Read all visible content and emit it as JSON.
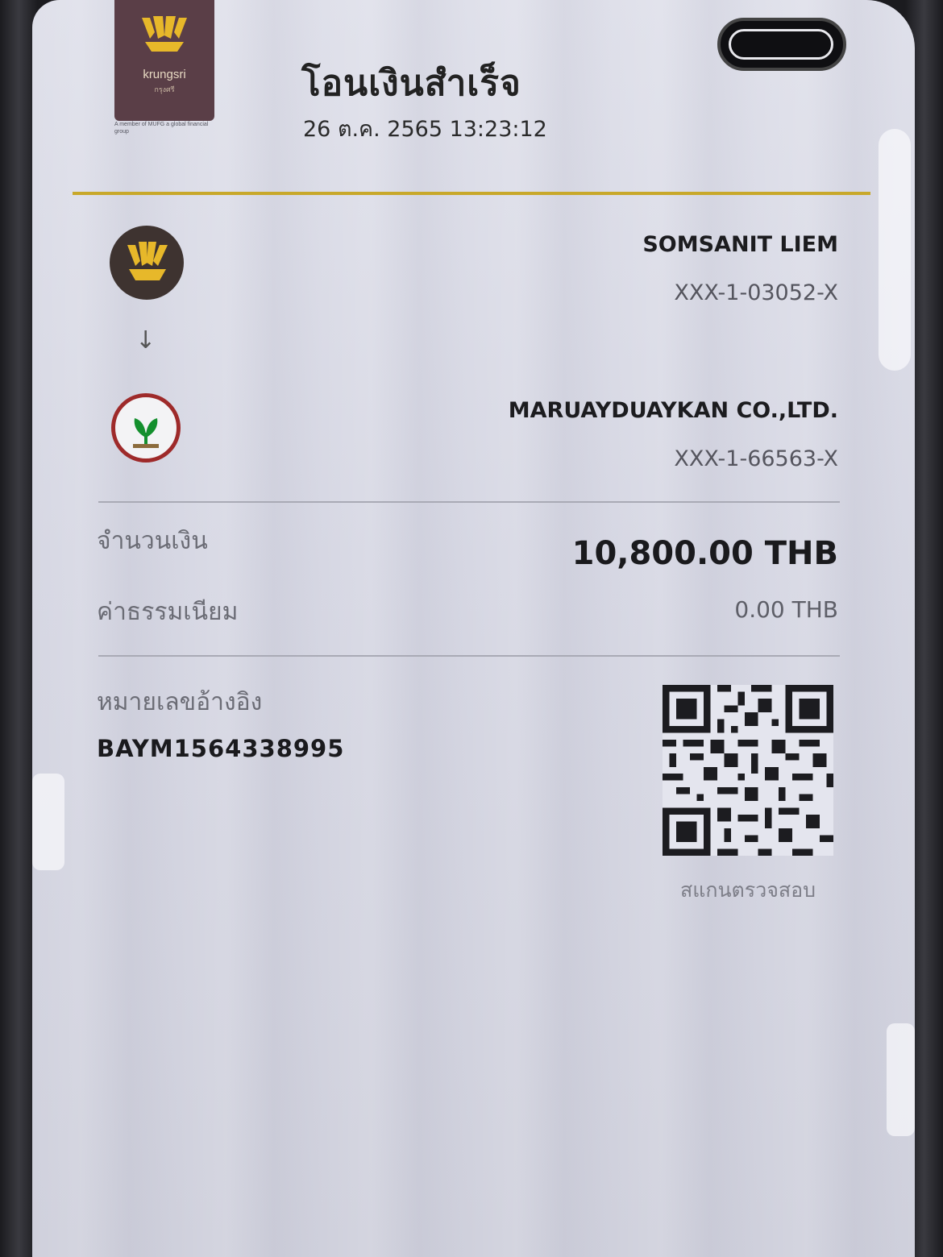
{
  "bank": {
    "name": "krungsri",
    "sub": "กรุงศรี",
    "member_text": "A member of MUFG a global financial group"
  },
  "header": {
    "title": "โอนเงินสำเร็จ",
    "datetime": "26 ต.ค. 2565 13:23:12"
  },
  "sender": {
    "logo": "krungsri-logo-icon",
    "name": "SOMSANIT LIEM",
    "account": "XXX-1-03052-X"
  },
  "arrow": "↓",
  "receiver": {
    "logo": "kbank-logo-icon",
    "name": "MARUAYDUAYKAN CO.,LTD.",
    "account": "XXX-1-66563-X"
  },
  "amount": {
    "label": "จำนวนเงิน",
    "value": "10,800.00 THB"
  },
  "fee": {
    "label": "ค่าธรรมเนียม",
    "value": "0.00 THB"
  },
  "reference": {
    "label": "หมายเลขอ้างอิง",
    "value": "BAYM1564338995"
  },
  "qr": {
    "caption": "สแกนตรวจสอบ"
  },
  "colors": {
    "gold_rule": "#c8a82a",
    "krungsri_brown": "#5a3e47",
    "krungsri_yellow": "#e7b82a",
    "kbank_green": "#138f2d",
    "kbank_red": "#9e2a2a"
  }
}
